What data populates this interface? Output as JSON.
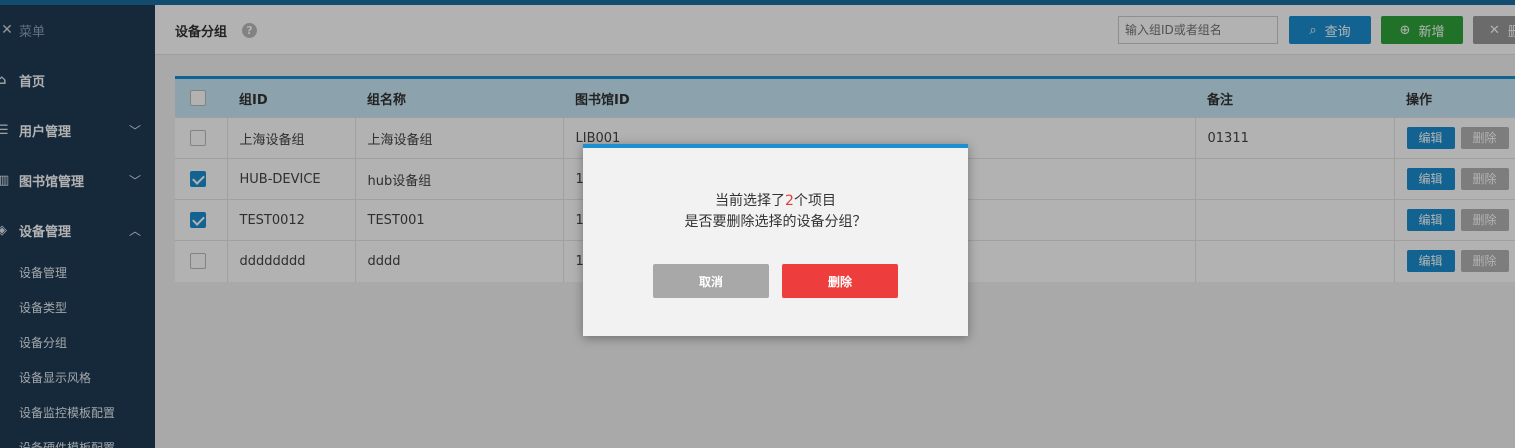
{
  "sidebar": {
    "menu_label": "菜单",
    "items": [
      {
        "label": "首页",
        "icon": "home-icon"
      },
      {
        "label": "用户管理",
        "icon": "list-icon",
        "chevron": "down"
      },
      {
        "label": "图书馆管理",
        "icon": "building-icon",
        "chevron": "down"
      },
      {
        "label": "设备管理",
        "icon": "device-icon",
        "chevron": "up"
      }
    ],
    "sub_items": [
      "设备管理",
      "设备类型",
      "设备分组",
      "设备显示风格",
      "设备监控模板配置",
      "设备硬件模板配置"
    ]
  },
  "header": {
    "title": "设备分组",
    "search_placeholder": "输入组ID或者组名",
    "search_button": "查询",
    "add_button": "新增",
    "delete_button": "删"
  },
  "table": {
    "columns": [
      "组ID",
      "组名称",
      "图书馆ID",
      "备注",
      "操作"
    ],
    "rows": [
      {
        "checked": false,
        "group_id": "上海设备组",
        "group_name": "上海设备组",
        "library_id": "LIB001",
        "remark": "01311"
      },
      {
        "checked": true,
        "group_id": "HUB-DEVICE",
        "group_name": "hub设备组",
        "library_id": "1",
        "remark": ""
      },
      {
        "checked": true,
        "group_id": "TEST0012",
        "group_name": "TEST001",
        "library_id": "1",
        "remark": ""
      },
      {
        "checked": false,
        "group_id": "dddddddd",
        "group_name": "dddd",
        "library_id": "1",
        "remark": ""
      }
    ],
    "edit_label": "编辑",
    "delete_label": "删除"
  },
  "dialog": {
    "line1_prefix": "当前选择了",
    "selected_count": "2",
    "line1_suffix": "个项目",
    "line2": "是否要删除选择的设备分组？",
    "cancel_label": "取消",
    "confirm_label": "删除"
  },
  "colors": {
    "accent": "#1b8fd0",
    "sidebar_bg": "#1f3b55",
    "add_green": "#2fa43a",
    "danger_red": "#ee3d3d"
  }
}
